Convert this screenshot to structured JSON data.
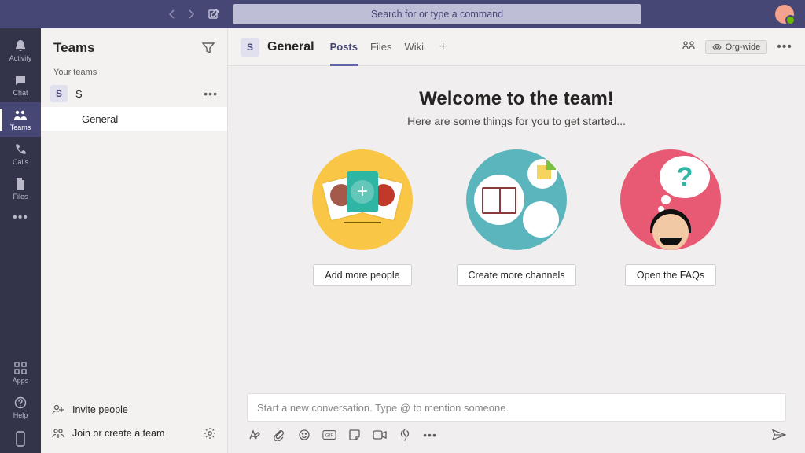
{
  "topbar": {
    "search_placeholder": "Search for or type a command"
  },
  "rail": {
    "items": [
      {
        "label": "Activity",
        "icon": "bell-icon"
      },
      {
        "label": "Chat",
        "icon": "chat-icon"
      },
      {
        "label": "Teams",
        "icon": "teams-icon"
      },
      {
        "label": "Calls",
        "icon": "phone-icon"
      },
      {
        "label": "Files",
        "icon": "file-icon"
      }
    ],
    "bottom": [
      {
        "label": "Apps",
        "icon": "apps-icon"
      },
      {
        "label": "Help",
        "icon": "help-icon"
      }
    ]
  },
  "sidebar": {
    "title": "Teams",
    "section_label": "Your teams",
    "team_letter": "S",
    "team_name": "S",
    "channel_name": "General",
    "invite_label": "Invite people",
    "join_label": "Join or create a team"
  },
  "channel": {
    "tile_letter": "S",
    "title": "General",
    "tabs": {
      "posts": "Posts",
      "files": "Files",
      "wiki": "Wiki"
    },
    "scope_badge": "Org-wide"
  },
  "welcome": {
    "title": "Welcome to the team!",
    "subtitle": "Here are some things for you to get started...",
    "cards": {
      "add_people": "Add more people",
      "create_channels": "Create more channels",
      "open_faqs": "Open the FAQs"
    }
  },
  "composer": {
    "placeholder": "Start a new conversation. Type @ to mention someone."
  }
}
